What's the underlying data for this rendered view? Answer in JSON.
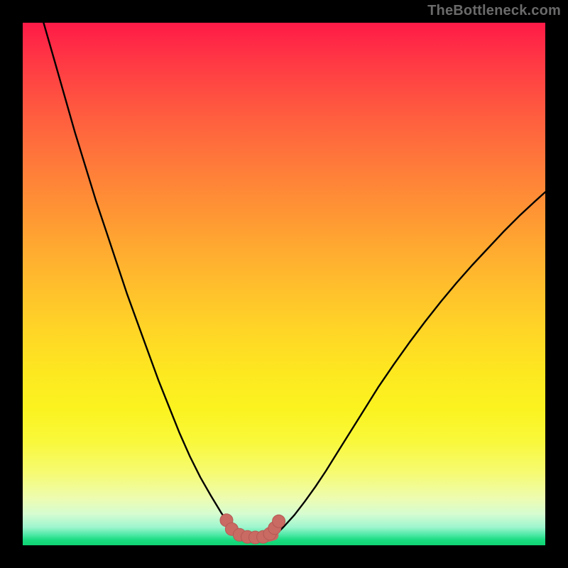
{
  "watermark": "TheBottleneck.com",
  "colors": {
    "curve": "#000000",
    "marker_fill": "#c96a63",
    "marker_stroke": "#b65a54"
  },
  "chart_data": {
    "type": "line",
    "title": "",
    "xlabel": "",
    "ylabel": "",
    "xlim": [
      0,
      100
    ],
    "ylim": [
      0,
      100
    ],
    "grid": false,
    "legend": false,
    "series": [
      {
        "name": "left-curve",
        "x": [
          4,
          6,
          8,
          10,
          12,
          14,
          16,
          18,
          20,
          22,
          24,
          26,
          28,
          30,
          32,
          34,
          36,
          38,
          39,
          40,
          41,
          42
        ],
        "y": [
          100,
          93,
          86,
          79,
          72.5,
          66,
          60,
          54,
          48,
          42.5,
          37,
          31.5,
          26.5,
          21.5,
          17,
          13,
          9.5,
          6.2,
          4.8,
          3.6,
          2.6,
          1.9
        ]
      },
      {
        "name": "right-curve",
        "x": [
          48,
          49,
          50,
          52,
          54,
          56,
          58,
          60,
          62,
          65,
          68,
          71,
          74,
          77,
          80,
          83,
          86,
          89,
          92,
          95,
          98,
          100
        ],
        "y": [
          1.9,
          2.6,
          3.6,
          5.8,
          8.4,
          11.2,
          14.2,
          17.4,
          20.6,
          25.4,
          30.2,
          34.6,
          38.8,
          42.8,
          46.6,
          50.2,
          53.6,
          56.8,
          60.0,
          63.0,
          65.8,
          67.6
        ]
      },
      {
        "name": "floor-segment",
        "x": [
          42,
          43,
          44,
          45,
          46,
          47,
          48
        ],
        "y": [
          1.9,
          1.6,
          1.5,
          1.5,
          1.5,
          1.6,
          1.9
        ]
      }
    ],
    "markers": [
      {
        "x": 39.0,
        "y": 4.8
      },
      {
        "x": 40.0,
        "y": 3.1
      },
      {
        "x": 41.5,
        "y": 2.0
      },
      {
        "x": 43.0,
        "y": 1.6
      },
      {
        "x": 44.5,
        "y": 1.5
      },
      {
        "x": 46.0,
        "y": 1.6
      },
      {
        "x": 47.3,
        "y": 2.2
      },
      {
        "x": 48.2,
        "y": 3.3
      },
      {
        "x": 49.0,
        "y": 4.6
      }
    ]
  }
}
